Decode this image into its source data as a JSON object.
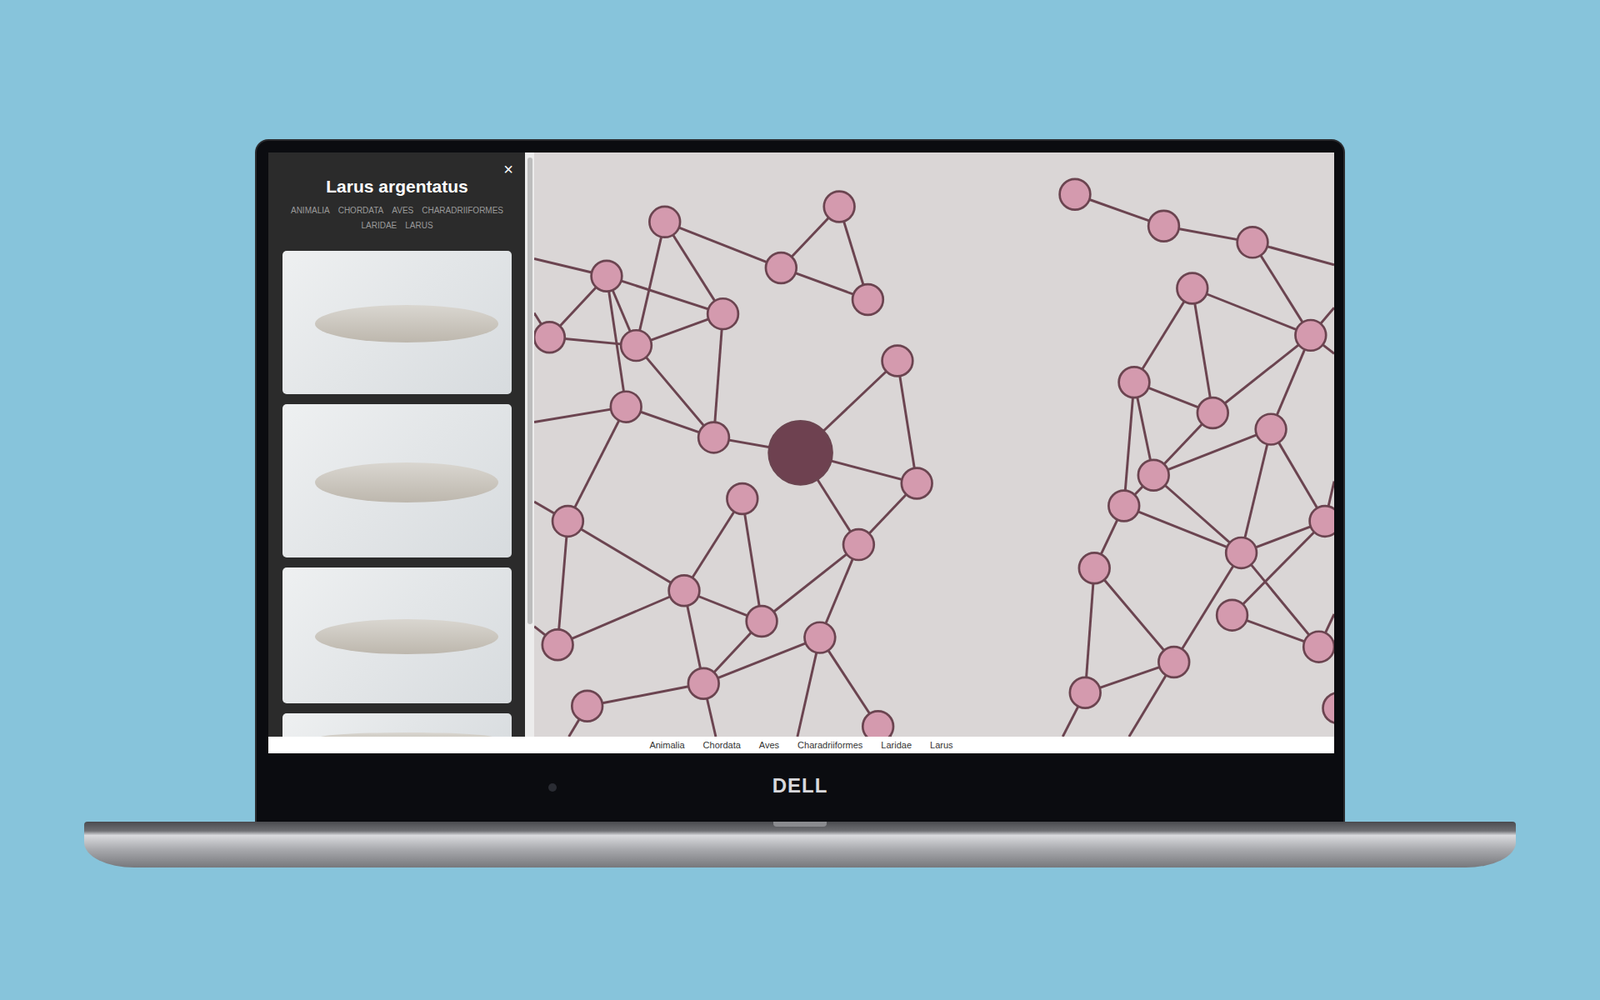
{
  "detail_panel": {
    "close": "×",
    "title": "Larus argentatus",
    "taxonomy": [
      "ANIMALIA",
      "CHORDATA",
      "AVES",
      "CHARADRIIFORMES",
      "LARIDAE",
      "LARUS"
    ]
  },
  "graph": {
    "nodes": [
      {
        "selected": true
      },
      {
        "selected": false
      },
      {
        "selected": false
      },
      {
        "selected": false
      },
      {
        "selected": false
      },
      {
        "selected": false
      },
      {
        "selected": false
      },
      {
        "selected": false
      },
      {
        "selected": false
      },
      {
        "selected": false
      },
      {
        "selected": false
      },
      {
        "selected": false
      },
      {
        "selected": false
      },
      {
        "selected": false
      },
      {
        "selected": false
      },
      {
        "selected": false
      },
      {
        "selected": false
      },
      {
        "selected": false
      },
      {
        "selected": false
      },
      {
        "selected": false
      },
      {
        "selected": false
      },
      {
        "selected": false
      },
      {
        "selected": false
      },
      {
        "selected": false
      },
      {
        "selected": false
      },
      {
        "selected": false
      },
      {
        "selected": false
      },
      {
        "selected": false
      },
      {
        "selected": false
      },
      {
        "selected": false
      },
      {
        "selected": false
      },
      {
        "selected": false
      },
      {
        "selected": false
      },
      {
        "selected": false
      },
      {
        "selected": false
      },
      {
        "selected": false
      },
      {
        "selected": false
      },
      {
        "selected": false
      },
      {
        "selected": false
      },
      {
        "selected": false
      },
      {
        "selected": false
      }
    ]
  },
  "breadcrumb": [
    "Animalia",
    "Chordata",
    "Aves",
    "Charadriiformes",
    "Laridae",
    "Larus"
  ],
  "laptop": {
    "logo": "DELL"
  }
}
